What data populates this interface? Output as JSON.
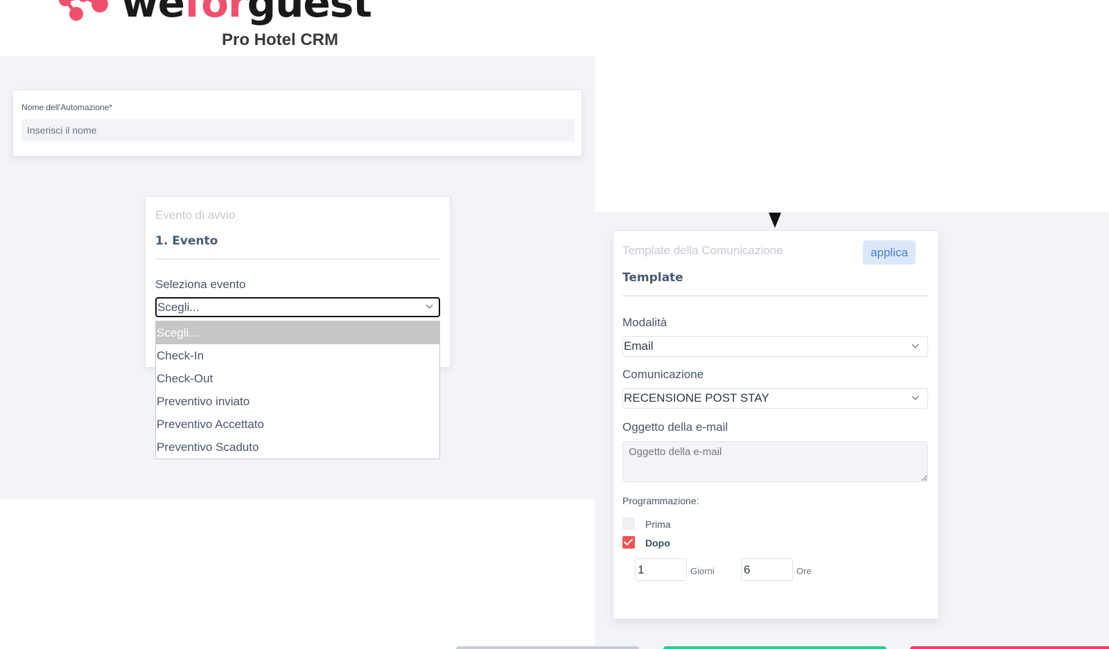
{
  "brand": {
    "logo_text_left": "we",
    "logo_text_accent": "for",
    "logo_text_right": "guest",
    "subtitle": "Pro Hotel CRM",
    "accent_color": "#f0506e"
  },
  "automation_name": {
    "label": "Nome dell'Automazione*",
    "placeholder": "Inserisci il nome",
    "value": ""
  },
  "event_card": {
    "subtitle": "Evento di avvio",
    "title": "1. Evento",
    "select_label": "Seleziona evento",
    "selected_value": "Scegli...",
    "options": [
      "Scegli...",
      "Check-In",
      "Check-Out",
      "Preventivo inviato",
      "Preventivo Accettato",
      "Preventivo Scaduto"
    ],
    "highlighted_option": "Scegli..."
  },
  "template_card": {
    "subtitle": "Template della Comunicazione",
    "apply_label": "applica",
    "title": "Template",
    "mode_label": "Modalità",
    "mode_value": "Email",
    "communication_label": "Comunicazione",
    "communication_value": "RECENSIONE POST STAY",
    "subject_label": "Oggetto della e-mail",
    "subject_placeholder": "Oggetto della e-mail",
    "schedule_label": "Programmazione:",
    "before_label": "Prima",
    "before_checked": false,
    "after_label": "Dopo",
    "after_checked": true,
    "days_value": "1",
    "days_unit": "Giorni",
    "hours_value": "6",
    "hours_unit": "Ore"
  },
  "colors": {
    "panel_bg": "#f3f4f8",
    "checkbox_on": "#ef5350",
    "apply_bg": "#dbe7fb",
    "apply_text": "#4a7fd4",
    "bottom_bar_grey": "#c9ccd3",
    "bottom_bar_green": "#2ecc8b",
    "bottom_bar_red": "#ee3e68"
  }
}
